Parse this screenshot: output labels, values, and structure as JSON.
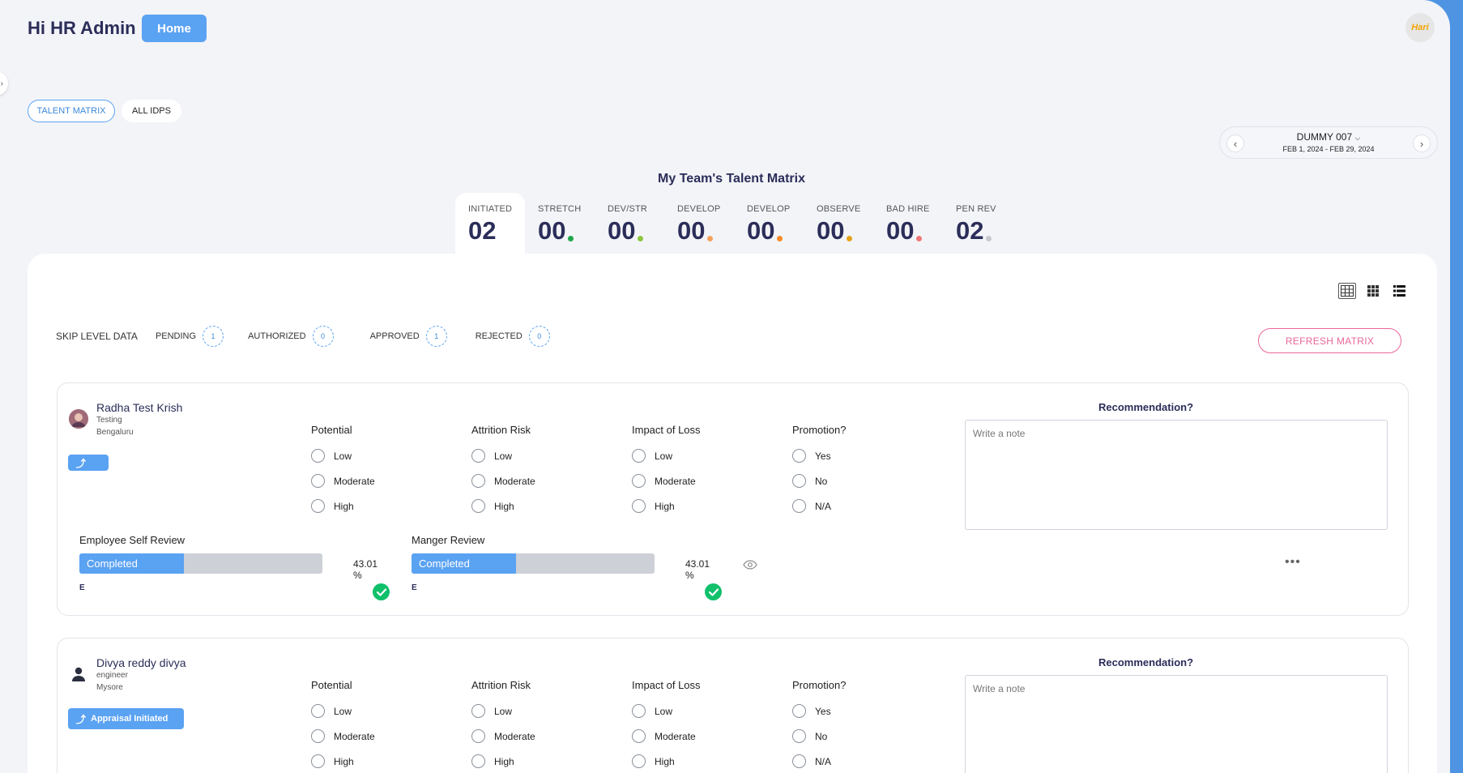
{
  "header": {
    "greeting": "Hi HR Admin",
    "home_label": "Home",
    "avatar_text": "Hari"
  },
  "tabs": [
    {
      "label": "TALENT MATRIX",
      "active": true
    },
    {
      "label": "ALL IDPS",
      "active": false
    }
  ],
  "period": {
    "name": "DUMMY 007",
    "range": "FEB 1, 2024 - FEB 29, 2024"
  },
  "matrix": {
    "title": "My Team's Talent Matrix",
    "stats": [
      {
        "label": "INITIATED",
        "value": "02",
        "color": "",
        "active": true
      },
      {
        "label": "STRETCH",
        "value": "00",
        "color": "#1fa64a",
        "active": false
      },
      {
        "label": "DEV/STR",
        "value": "00",
        "color": "#8dc63f",
        "active": false
      },
      {
        "label": "DEVELOP",
        "value": "00",
        "color": "#f5a25d",
        "active": false
      },
      {
        "label": "DEVELOP",
        "value": "00",
        "color": "#f58a2b",
        "active": false
      },
      {
        "label": "OBSERVE",
        "value": "00",
        "color": "#e3a41c",
        "active": false
      },
      {
        "label": "BAD HIRE",
        "value": "00",
        "color": "#f07878",
        "active": false
      },
      {
        "label": "PEN REV",
        "value": "02",
        "color": "#c7c9cf",
        "active": false
      }
    ]
  },
  "skip_level": {
    "title": "SKIP LEVEL DATA",
    "items": [
      {
        "label": "PENDING",
        "count": "1"
      },
      {
        "label": "AUTHORIZED",
        "count": "0"
      },
      {
        "label": "APPROVED",
        "count": "1"
      },
      {
        "label": "REJECTED",
        "count": "0"
      }
    ]
  },
  "refresh_label": "REFRESH MATRIX",
  "assessment": {
    "potential": {
      "title": "Potential",
      "options": [
        "Low",
        "Moderate",
        "High"
      ]
    },
    "attrition": {
      "title": "Attrition Risk",
      "options": [
        "Low",
        "Moderate",
        "High"
      ]
    },
    "impact": {
      "title": "Impact of Loss",
      "options": [
        "Low",
        "Moderate",
        "High"
      ]
    },
    "promotion": {
      "title": "Promotion?",
      "options": [
        "Yes",
        "No",
        "N/A"
      ]
    },
    "recommendation_title": "Recommendation?",
    "note_placeholder": "Write a note"
  },
  "employees": [
    {
      "name": "Radha Test Krish",
      "role": "Testing",
      "location": "Bengaluru",
      "status": "",
      "self_review": {
        "title": "Employee Self Review",
        "status": "Completed",
        "percent": "43.01 %",
        "fill": 0.43,
        "initial": "E"
      },
      "manager_review": {
        "title": "Manger Review",
        "status": "Completed",
        "percent": "43.01 %",
        "fill": 0.43,
        "initial": "E"
      }
    },
    {
      "name": "Divya reddy divya",
      "role": "engineer",
      "location": "Mysore",
      "status": "Appraisal Initiated"
    }
  ]
}
